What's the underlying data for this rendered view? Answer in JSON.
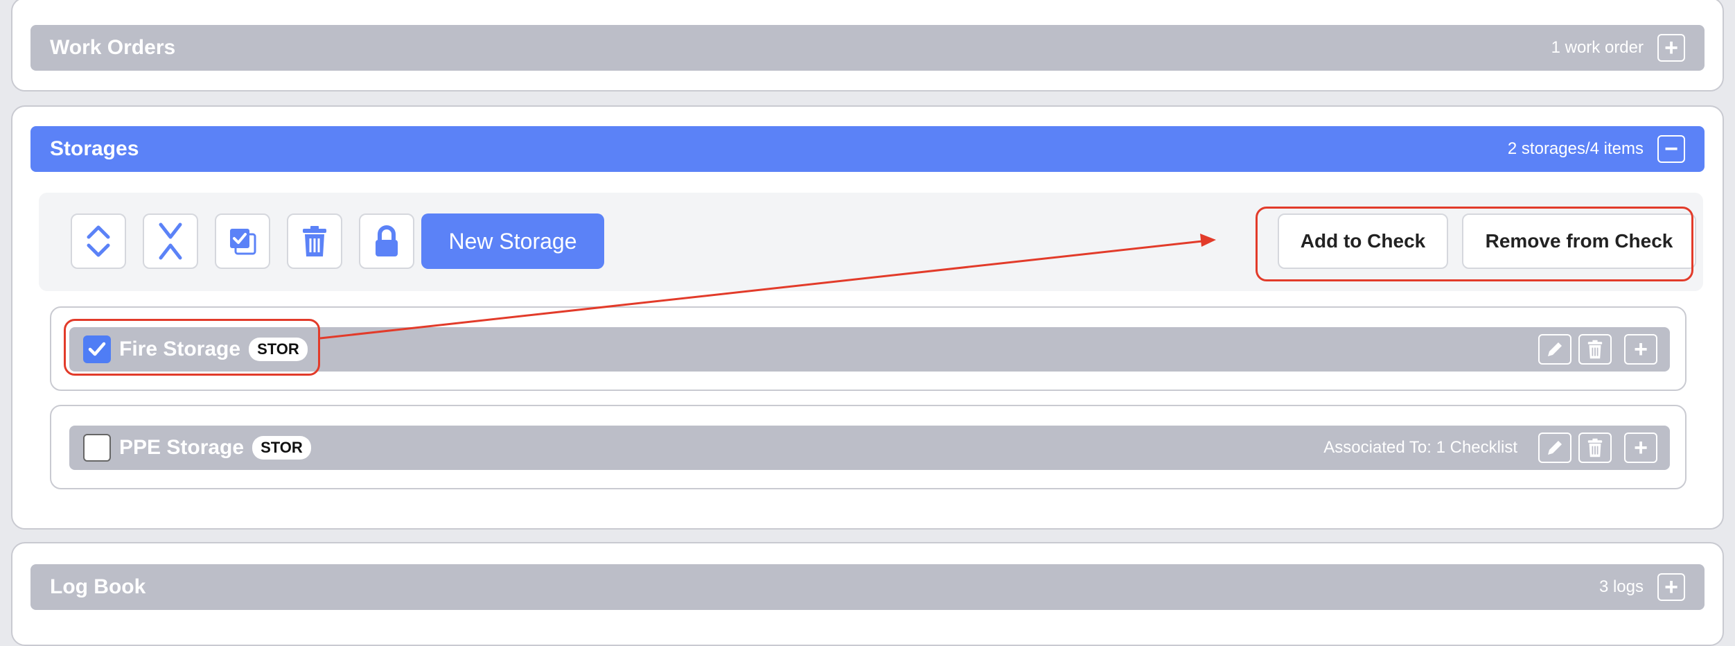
{
  "work_orders": {
    "title": "Work Orders",
    "count": "1 work order",
    "toggle": "+"
  },
  "storages": {
    "title": "Storages",
    "count": "2 storages/4 items",
    "toggle": "−",
    "toolbar": {
      "icons": [
        "expand-all-icon",
        "collapse-all-icon",
        "select-all-icon",
        "trash-icon",
        "lock-icon"
      ],
      "new_storage_label": "New Storage",
      "add_to_check_label": "Add to Check",
      "remove_from_check_label": "Remove from Check"
    },
    "items": [
      {
        "name": "Fire Storage",
        "badge": "STOR",
        "checked": true,
        "associated": "",
        "add": "+"
      },
      {
        "name": "PPE Storage",
        "badge": "STOR",
        "checked": false,
        "associated": "Associated To: 1 Checklist",
        "add": "+"
      }
    ]
  },
  "log_book": {
    "title": "Log Book",
    "count": "3 logs",
    "toggle": "+"
  },
  "colors": {
    "accent": "#5b82f7",
    "bar_gray": "#bcbec8",
    "annotation_red": "#e23b2a"
  }
}
